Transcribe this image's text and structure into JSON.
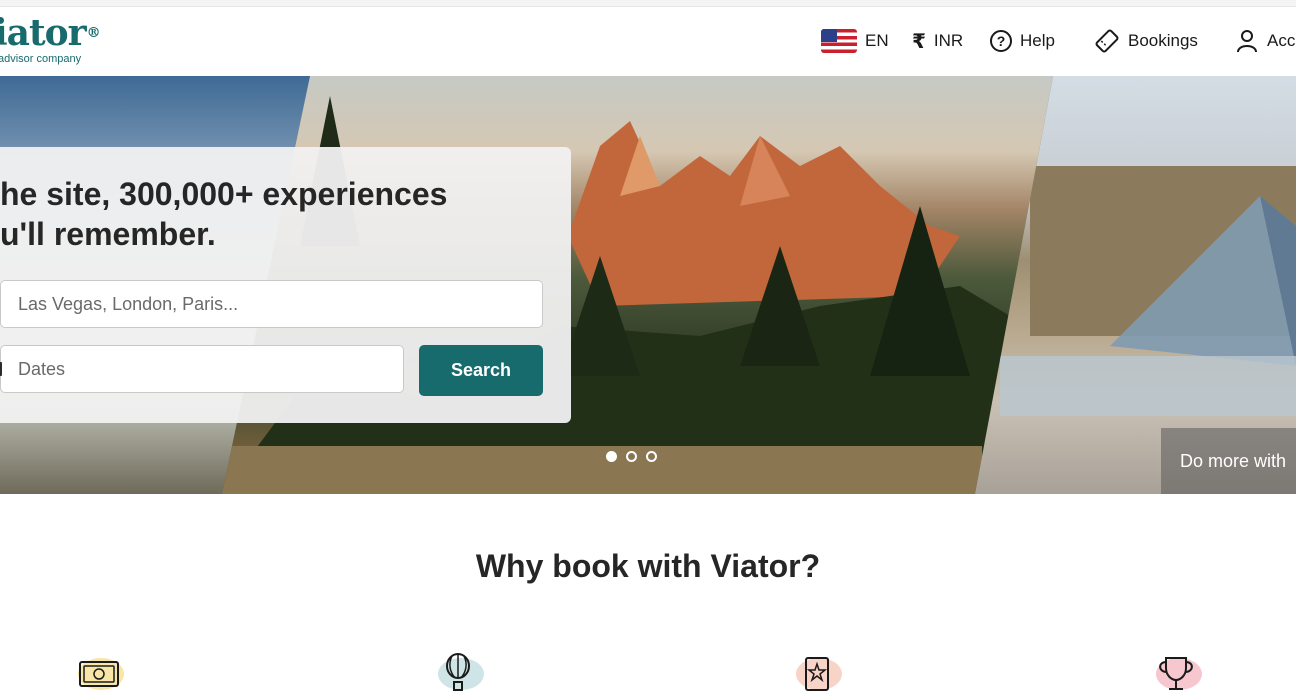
{
  "header": {
    "logo_text": "iator",
    "logo_mark": "®",
    "logo_sub": "advisor company",
    "language": "EN",
    "currency_symbol": "₹",
    "currency": "INR",
    "help": "Help",
    "bookings": "Bookings",
    "account": "Acc"
  },
  "hero": {
    "headline_line1": "he site, 300,000+ experiences",
    "headline_line2": "u'll remember.",
    "destination_placeholder": "Las Vegas, London, Paris...",
    "dates_placeholder": "Dates",
    "search_label": "Search",
    "caption": "Do more with",
    "active_slide": 1,
    "slide_count": 3
  },
  "why": {
    "title": "Why book with Viator?",
    "features": [
      {
        "icon": "money-icon",
        "blob_color": "#f8e6a6"
      },
      {
        "icon": "hot-air-balloon-icon",
        "blob_color": "#cfe4e6"
      },
      {
        "icon": "star-certificate-icon",
        "blob_color": "#f8d3c8"
      },
      {
        "icon": "trophy-icon",
        "blob_color": "#f7c7cf"
      }
    ]
  },
  "colors": {
    "brand": "#186b6d",
    "text": "#1a1a1a"
  }
}
